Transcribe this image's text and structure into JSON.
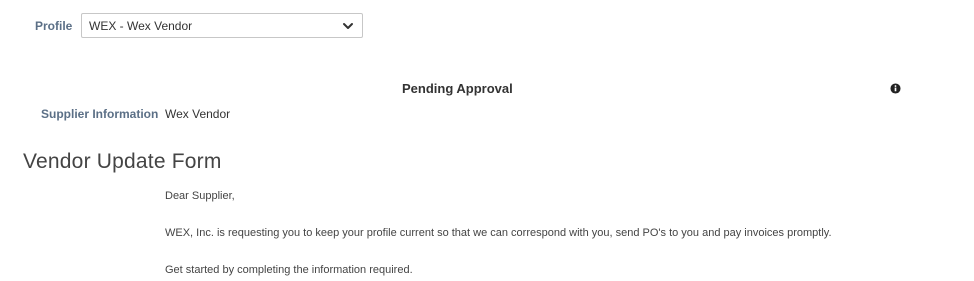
{
  "profile": {
    "label": "Profile",
    "selected": "WEX - Wex Vendor",
    "dropdown_icon": "chevron-down-icon"
  },
  "status": {
    "title": "Pending Approval",
    "info_icon": "info-icon"
  },
  "supplier": {
    "label": "Supplier Information",
    "value": "Wex Vendor"
  },
  "form": {
    "title": "Vendor Update Form",
    "greeting": "Dear Supplier,",
    "message": "WEX, Inc. is requesting you to keep your profile current so that we can correspond with you, send PO's to you and pay invoices promptly.",
    "instruction": "Get started by completing the information required."
  },
  "colors": {
    "label_text": "#5b6f86",
    "body_text": "#333333",
    "border": "#c7c7c7"
  }
}
